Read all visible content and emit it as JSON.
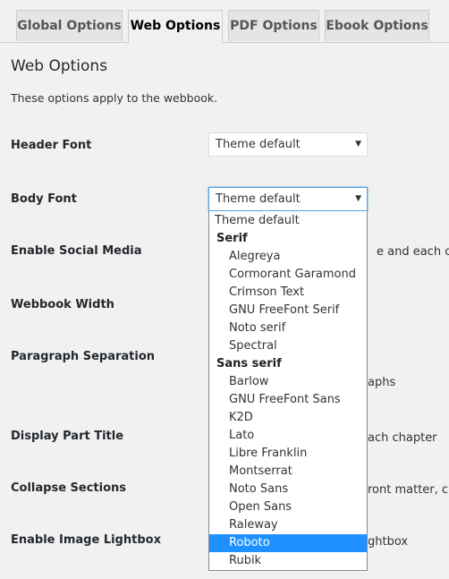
{
  "tabs": [
    "Global Options",
    "Web Options",
    "PDF Options",
    "Ebook Options"
  ],
  "heading": "Web Options",
  "intro": "These options apply to the webbook.",
  "fields": {
    "header_font": "Header Font",
    "body_font": "Body Font",
    "enable_social_media": "Enable Social Media",
    "webbook_width": "Webbook Width",
    "paragraph_separation": "Paragraph Separation",
    "display_part_title": "Display Part Title",
    "collapse_sections": "Collapse Sections",
    "enable_image_lightbox": "Enable Image Lightbox"
  },
  "header_font_select": {
    "value": "Theme default"
  },
  "body_font_select": {
    "value": "Theme default"
  },
  "arrow": "▼",
  "partial_text": {
    "social": "e and each cha",
    "paragraph": "aphs",
    "part_title": "ach chapter",
    "collapse": "ront matter, cha",
    "lightbox": "ghtbox"
  },
  "dropdown": {
    "options": [
      "Theme default",
      "Serif",
      "Alegreya",
      "Cormorant Garamond",
      "Crimson Text",
      "GNU FreeFont Serif",
      "Noto serif",
      "Spectral",
      "Sans serif",
      "Barlow",
      "GNU FreeFont Sans",
      "K2D",
      "Lato",
      "Libre Franklin",
      "Montserrat",
      "Noto Sans",
      "Open Sans",
      "Raleway",
      "Roboto",
      "Rubik"
    ],
    "highlighted": "Roboto"
  }
}
